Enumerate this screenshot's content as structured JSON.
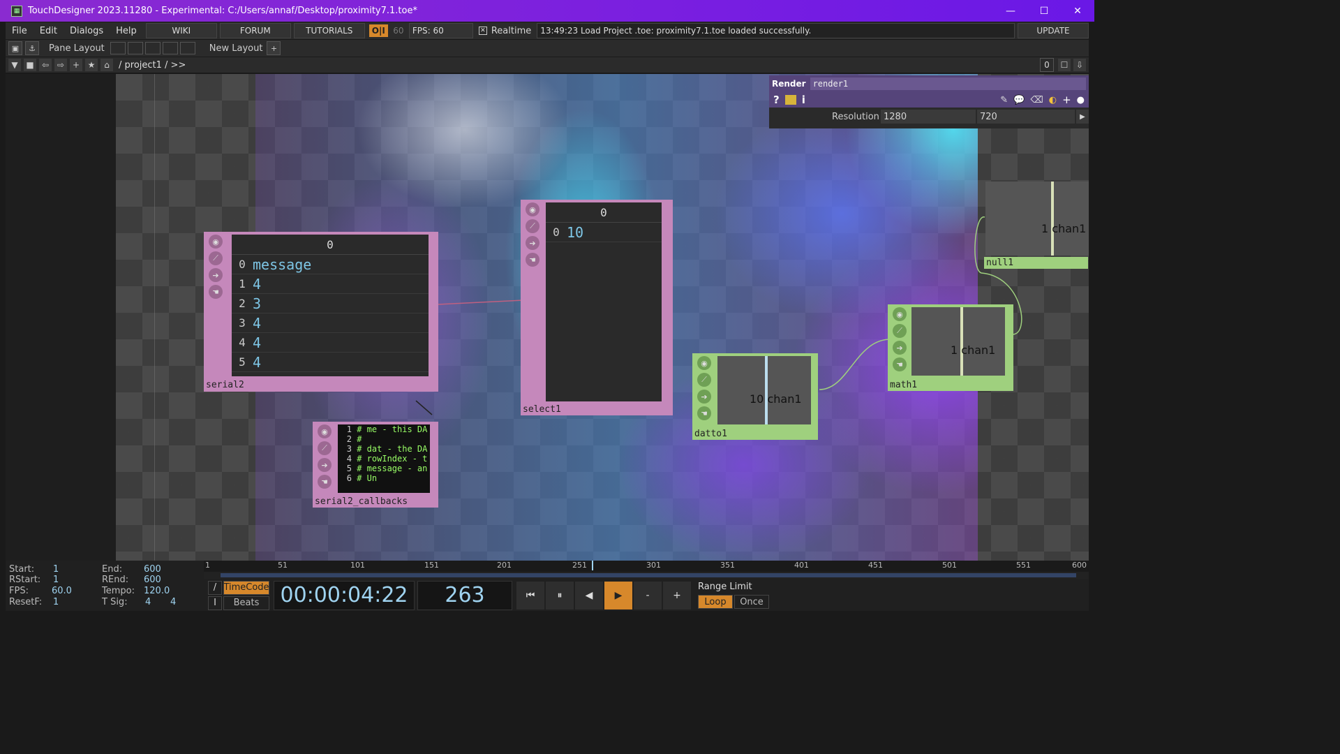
{
  "window": {
    "title": "TouchDesigner 2023.11280 - Experimental: C:/Users/annaf/Desktop/proximity7.1.toe*",
    "buttons": [
      "—",
      "☐",
      "✕"
    ]
  },
  "menubar": {
    "items": [
      "File",
      "Edit",
      "Dialogs",
      "Help"
    ],
    "links": [
      "WIKI",
      "FORUM",
      "TUTORIALS"
    ],
    "oi": "O|I",
    "fps_target": "60",
    "fps_label": "FPS:  60",
    "realtime_label": "Realtime",
    "realtime_check": "✕",
    "status": "13:49:23 Load Project .toe: proximity7.1.toe loaded successfully.",
    "update": "UPDATE"
  },
  "toolbar": {
    "pane_layout": "Pane Layout",
    "new_layout": "New Layout",
    "add": "+"
  },
  "path": {
    "value": "/ project1 / >>",
    "right_value": "0"
  },
  "params": {
    "type": "Render",
    "name": "render1",
    "help": "?",
    "info": "i",
    "resolution_label": "Resolution",
    "res_w": "1280",
    "res_h": "720"
  },
  "nodes": {
    "serial2": {
      "label": "serial2",
      "header": "0",
      "rows": [
        {
          "i": "0",
          "v": "message"
        },
        {
          "i": "1",
          "v": "4"
        },
        {
          "i": "2",
          "v": "3"
        },
        {
          "i": "3",
          "v": "4"
        },
        {
          "i": "4",
          "v": "4"
        },
        {
          "i": "5",
          "v": "4"
        }
      ]
    },
    "select1": {
      "label": "select1",
      "header": "0",
      "rows": [
        {
          "i": "0",
          "v": "10"
        }
      ]
    },
    "serial2_callbacks": {
      "label": "serial2_callbacks",
      "lines": [
        {
          "n": "1",
          "t": "# me - this DA"
        },
        {
          "n": "2",
          "t": "#"
        },
        {
          "n": "3",
          "t": "# dat - the DA"
        },
        {
          "n": "4",
          "t": "# rowIndex - t"
        },
        {
          "n": "5",
          "t": "# message - an"
        },
        {
          "n": "6",
          "t": "#           Un"
        }
      ]
    },
    "datto1": {
      "label": "datto1",
      "value": "10 chan1"
    },
    "math1": {
      "label": "math1",
      "value": "1 chan1"
    },
    "null1": {
      "label": "null1",
      "value": "1 chan1"
    }
  },
  "timeline": {
    "start_label": "Start:",
    "start": "1",
    "end_label": "End:",
    "end": "600",
    "rstart_label": "RStart:",
    "rstart": "1",
    "rend_label": "REnd:",
    "rend": "600",
    "fps_label": "FPS:",
    "fps": "60.0",
    "tempo_label": "Tempo:",
    "tempo": "120.0",
    "resetf_label": "ResetF:",
    "resetf": "1",
    "tsig_label": "T Sig:",
    "tsig_a": "4",
    "tsig_b": "4",
    "ruler": [
      "1",
      "51",
      "101",
      "151",
      "201",
      "251",
      "301",
      "351",
      "401",
      "451",
      "501",
      "551",
      "600"
    ],
    "timecode": "TimeCode",
    "beats": "Beats",
    "time": "00:00:04:22",
    "frame": "263",
    "range_limit": "Range Limit",
    "loop": "Loop",
    "once": "Once",
    "btn_start": "⏮",
    "btn_pause": "⏸",
    "btn_back": "◀",
    "btn_play": "▶",
    "btn_minus": "-",
    "btn_plus": "+"
  },
  "colors": {
    "accent": "#d7882b",
    "title": "#7a1fe0",
    "dat": "#c588bb",
    "chop": "#9fd07e",
    "value": "#7ec6e6"
  }
}
